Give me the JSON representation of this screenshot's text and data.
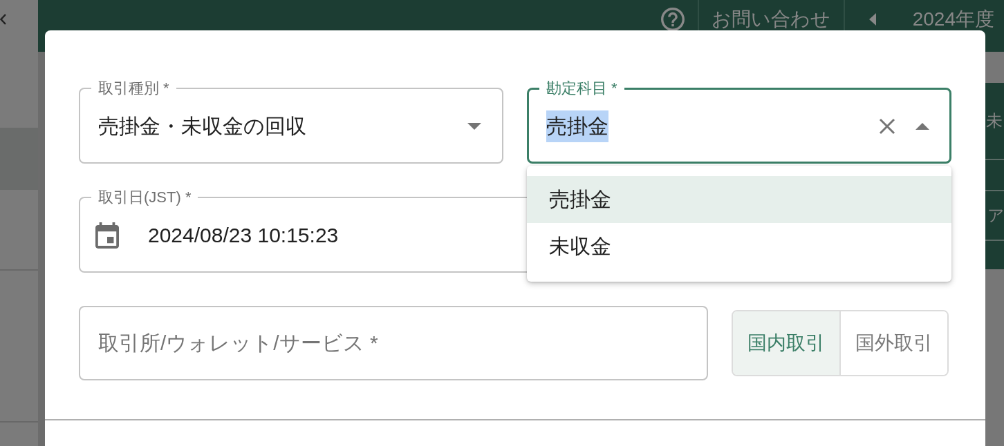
{
  "sidebar": {
    "items": [
      {
        "selected": true
      }
    ]
  },
  "top_bar": {
    "contact": "お問い合わせ",
    "fiscal_year": "2024年度"
  },
  "dialog": {
    "fields": [
      {
        "kind": "select",
        "label": "取引種別 *",
        "value": "売掛金・未収金の回収",
        "focused": false,
        "expanded": false
      },
      {
        "kind": "autocomplete",
        "label": "勘定科目 *",
        "value": "売掛金",
        "text_selected": true,
        "focused": true,
        "expanded": true,
        "options": [
          {
            "label": "売掛金",
            "selected": true
          },
          {
            "label": "未収金",
            "selected": false
          }
        ]
      },
      {
        "kind": "date",
        "label": "取引日(JST) *",
        "value": "2024/08/23 10:15:23"
      },
      {
        "kind": "text",
        "placeholder": "取引所/ウォレット/サービス *"
      }
    ],
    "region_toggle": [
      {
        "label": "国内取引",
        "selected": true
      },
      {
        "label": "国外取引",
        "selected": false
      }
    ]
  },
  "background_panel": {
    "rows": [
      "未",
      "ア"
    ]
  }
}
